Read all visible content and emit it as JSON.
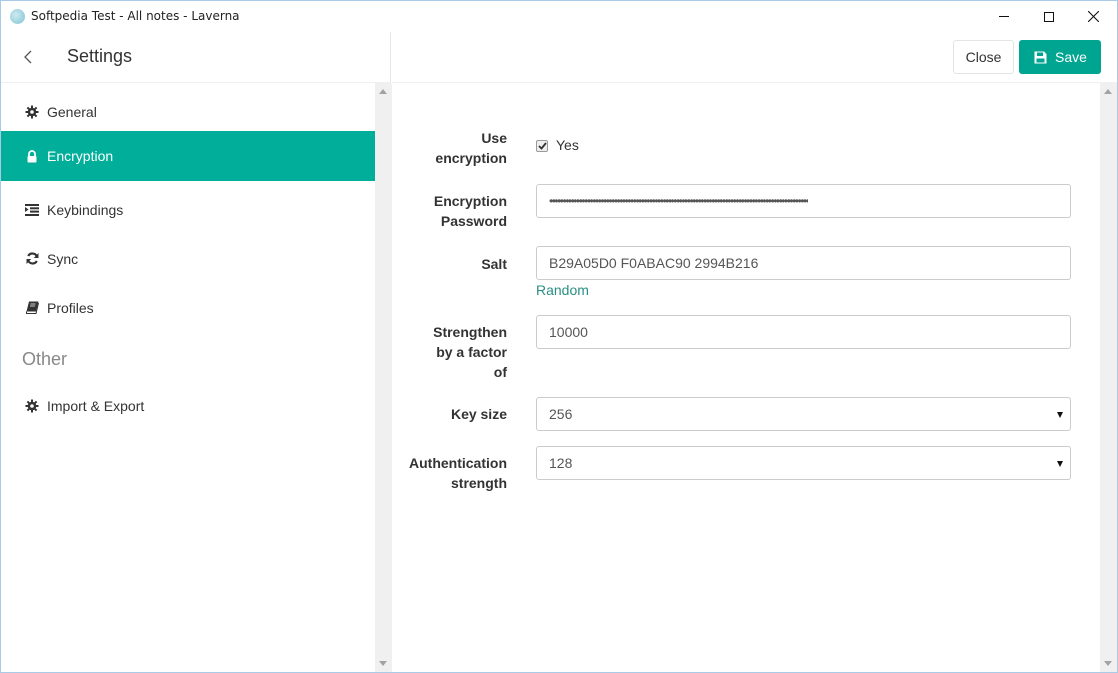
{
  "window": {
    "title": "Softpedia Test - All notes - Laverna",
    "controls": {
      "minimize": "minimize",
      "maximize": "maximize",
      "close": "close"
    }
  },
  "sidebar": {
    "title": "Settings",
    "back_icon": "chevron-left-icon",
    "items": [
      {
        "label": "General",
        "icon": "gear-icon",
        "active": false
      },
      {
        "label": "Encryption",
        "icon": "lock-icon",
        "active": true
      },
      {
        "label": "Keybindings",
        "icon": "indent-icon",
        "active": false
      },
      {
        "label": "Sync",
        "icon": "refresh-icon",
        "active": false
      },
      {
        "label": "Profiles",
        "icon": "book-icon",
        "active": false
      }
    ],
    "other_heading": "Other",
    "other_items": [
      {
        "label": "Import & Export",
        "icon": "gear-icon",
        "active": false
      }
    ]
  },
  "header": {
    "close_label": "Close",
    "save_label": "Save",
    "save_icon": "floppy-disk-icon"
  },
  "colors": {
    "accent": "#00ae9a",
    "save_button": "#00a592",
    "link": "#2a8f82"
  },
  "form": {
    "use_encryption": {
      "label_line1": "Use",
      "label_line2": "encryption",
      "checked": true,
      "option_label": "Yes"
    },
    "password": {
      "label_line1": "Encryption",
      "label_line2": "Password",
      "value_masked": "••••••••••••••••••••••••••••••••••••••••••••••••••••••••••••••••••••••••••••••••••••••••••••••••"
    },
    "salt": {
      "label": "Salt",
      "value": "B29A05D0 F0ABAC90 2994B216",
      "random_link": "Random"
    },
    "strengthen": {
      "label_line1": "Strengthen",
      "label_line2": "by a factor",
      "label_line3": "of",
      "value": "10000"
    },
    "key_size": {
      "label": "Key size",
      "value": "256"
    },
    "auth_strength": {
      "label_line1": "Authentication",
      "label_line2": "strength",
      "value": "128"
    }
  }
}
